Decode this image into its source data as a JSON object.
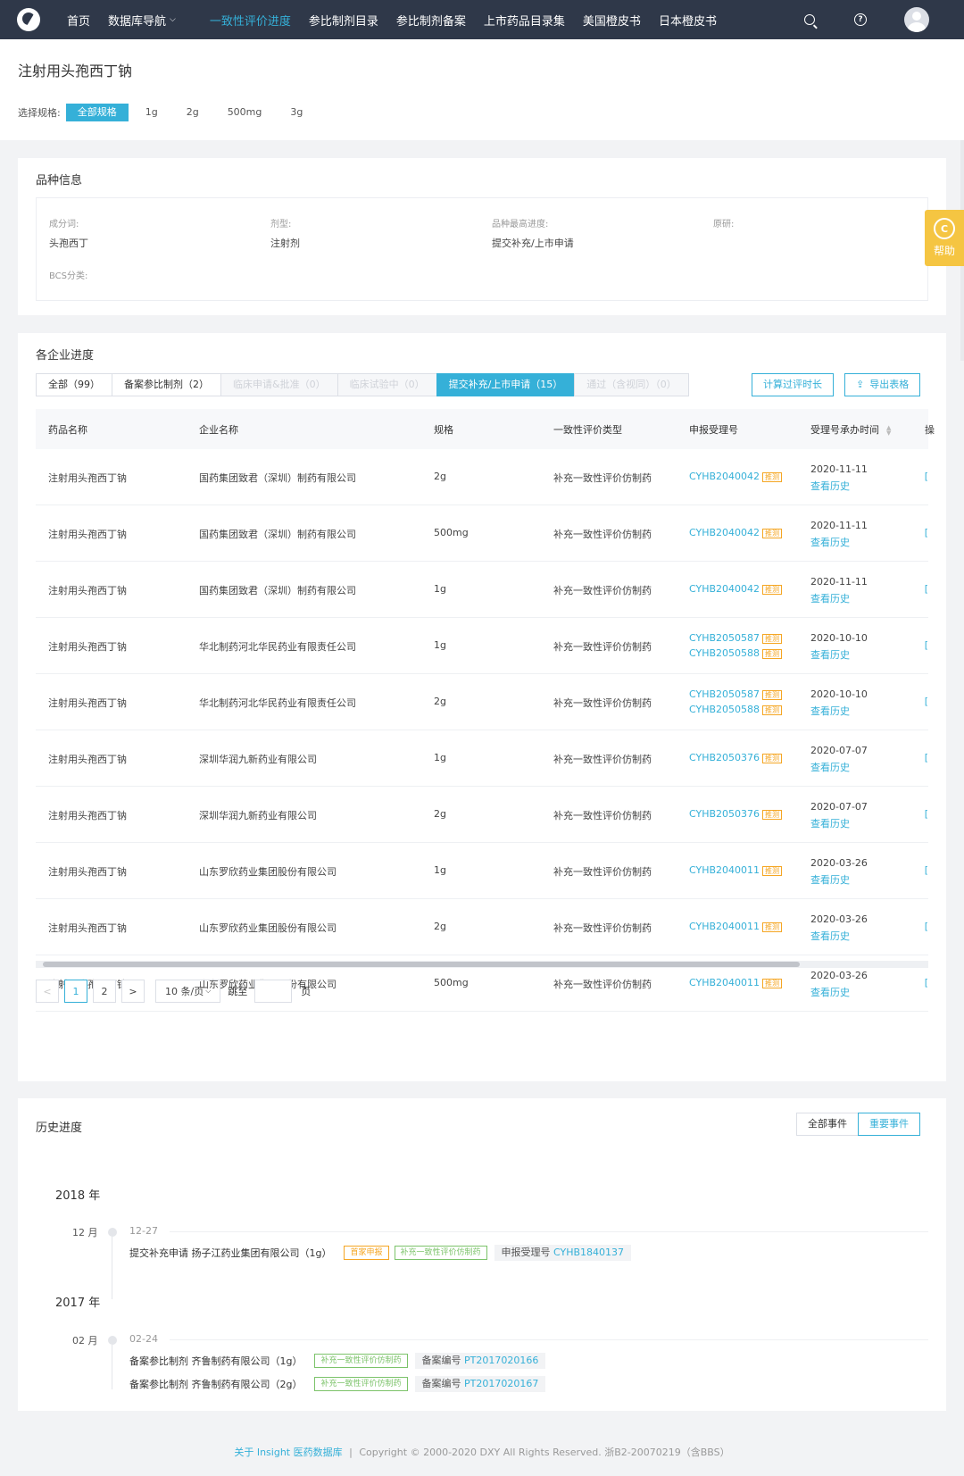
{
  "nav": {
    "items": [
      {
        "label": "首页"
      },
      {
        "label": "数据库导航",
        "has_dropdown": true
      },
      {
        "label": "一致性评价进度",
        "active": true
      },
      {
        "label": "参比制剂目录"
      },
      {
        "label": "参比制剂备案"
      },
      {
        "label": "上市药品目录集"
      },
      {
        "label": "美国橙皮书"
      },
      {
        "label": "日本橙皮书"
      }
    ],
    "accent_color": "#35b0d8",
    "bg_color": "#2f3849"
  },
  "page": {
    "title": "注射用头孢西丁钠",
    "spec_label": "选择规格:",
    "specs": [
      "全部规格",
      "1g",
      "2g",
      "500mg",
      "3g"
    ]
  },
  "variety": {
    "title": "品种信息",
    "fields": [
      {
        "key": "成分词:",
        "value": "头孢西丁"
      },
      {
        "key": "剂型:",
        "value": "注射剂"
      },
      {
        "key": "品种最高进度:",
        "value": "提交补充/上市申请"
      },
      {
        "key": "原研:",
        "value": ""
      },
      {
        "key": "BCS分类:",
        "value": ""
      }
    ]
  },
  "help_float": {
    "label": "帮助"
  },
  "progress": {
    "title": "各企业进度",
    "tabs": [
      {
        "label": "全部（99）",
        "state": "normal"
      },
      {
        "label": "备案参比制剂（2）",
        "state": "normal"
      },
      {
        "label": "临床申请&批准（0）",
        "state": "disabled"
      },
      {
        "label": "临床试验中（0）",
        "state": "disabled"
      },
      {
        "label": "提交补充/上市申请（15）",
        "state": "active"
      },
      {
        "label": "通过（含视同）（0）",
        "state": "disabled"
      }
    ],
    "btn_calc": "计算过评时长",
    "btn_export": "导出表格",
    "columns": [
      "药品名称",
      "企业名称",
      "规格",
      "一致性评价类型",
      "申报受理号",
      "受理号承办时间"
    ],
    "tuice_label": "推测",
    "history_label": "查看历史",
    "edge_label": "[",
    "rows": [
      {
        "drug": "注射用头孢西丁钠",
        "company": "国药集团致君（深圳）制药有限公司",
        "spec": "2g",
        "type": "补充一致性评价仿制药",
        "numbers": [
          "CYHB2040042"
        ],
        "date": "2020-11-11"
      },
      {
        "drug": "注射用头孢西丁钠",
        "company": "国药集团致君（深圳）制药有限公司",
        "spec": "500mg",
        "type": "补充一致性评价仿制药",
        "numbers": [
          "CYHB2040042"
        ],
        "date": "2020-11-11"
      },
      {
        "drug": "注射用头孢西丁钠",
        "company": "国药集团致君（深圳）制药有限公司",
        "spec": "1g",
        "type": "补充一致性评价仿制药",
        "numbers": [
          "CYHB2040042"
        ],
        "date": "2020-11-11"
      },
      {
        "drug": "注射用头孢西丁钠",
        "company": "华北制药河北华民药业有限责任公司",
        "spec": "1g",
        "type": "补充一致性评价仿制药",
        "numbers": [
          "CYHB2050587",
          "CYHB2050588"
        ],
        "date": "2020-10-10"
      },
      {
        "drug": "注射用头孢西丁钠",
        "company": "华北制药河北华民药业有限责任公司",
        "spec": "2g",
        "type": "补充一致性评价仿制药",
        "numbers": [
          "CYHB2050587",
          "CYHB2050588"
        ],
        "date": "2020-10-10"
      },
      {
        "drug": "注射用头孢西丁钠",
        "company": "深圳华润九新药业有限公司",
        "spec": "1g",
        "type": "补充一致性评价仿制药",
        "numbers": [
          "CYHB2050376"
        ],
        "date": "2020-07-07"
      },
      {
        "drug": "注射用头孢西丁钠",
        "company": "深圳华润九新药业有限公司",
        "spec": "2g",
        "type": "补充一致性评价仿制药",
        "numbers": [
          "CYHB2050376"
        ],
        "date": "2020-07-07"
      },
      {
        "drug": "注射用头孢西丁钠",
        "company": "山东罗欣药业集团股份有限公司",
        "spec": "1g",
        "type": "补充一致性评价仿制药",
        "numbers": [
          "CYHB2040011"
        ],
        "date": "2020-03-26"
      },
      {
        "drug": "注射用头孢西丁钠",
        "company": "山东罗欣药业集团股份有限公司",
        "spec": "2g",
        "type": "补充一致性评价仿制药",
        "numbers": [
          "CYHB2040011"
        ],
        "date": "2020-03-26"
      },
      {
        "drug": "注射用头孢西丁钠",
        "company": "山东罗欣药业集团股份有限公司",
        "spec": "500mg",
        "type": "补充一致性评价仿制药",
        "numbers": [
          "CYHB2040011"
        ],
        "date": "2020-03-26"
      }
    ],
    "pager": {
      "prev": "<",
      "pages": [
        "1",
        "2"
      ],
      "current": "1",
      "next": ">",
      "page_size": "10 条/页",
      "jump_label": "跳至",
      "page_suffix": "页"
    }
  },
  "history": {
    "title": "历史进度",
    "btn_all": "全部事件",
    "btn_important": "重要事件",
    "years": [
      {
        "year": "2018 年",
        "months": [
          {
            "month": "12 月",
            "date": "12-27",
            "events": [
              {
                "text": "提交补充申请 扬子江药业集团有限公司（1g）",
                "tags_orange": [
                  "首家申报"
                ],
                "tags_green": [
                  "补充一致性评价仿制药"
                ],
                "ref_label": "申报受理号",
                "ref_value": "CYHB1840137"
              }
            ]
          }
        ]
      },
      {
        "year": "2017 年",
        "months": [
          {
            "month": "02 月",
            "date": "02-24",
            "events": [
              {
                "text": "备案参比制剂 齐鲁制药有限公司（1g）",
                "tags_orange": [],
                "tags_green": [
                  "补充一致性评价仿制药"
                ],
                "ref_label": "备案编号",
                "ref_value": "PT2017020166"
              },
              {
                "text": "备案参比制剂 齐鲁制药有限公司（2g）",
                "tags_orange": [],
                "tags_green": [
                  "补充一致性评价仿制药"
                ],
                "ref_label": "备案编号",
                "ref_value": "PT2017020167"
              }
            ]
          }
        ]
      }
    ]
  },
  "footer": {
    "link": "关于 Insight 医药数据库",
    "sep": "|",
    "text": "Copyright © 2000-2020 DXY All Rights Reserved. 浙B2-20070219（含BBS）"
  }
}
